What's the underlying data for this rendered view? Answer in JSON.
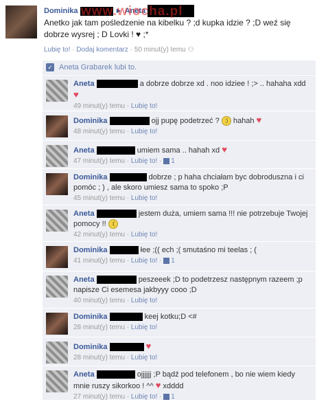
{
  "post": {
    "author": "Dominika",
    "target": "Aneta",
    "watermark": "www.wiocha.pl",
    "text": "Anetko jak tam pośledzenie na kibelku ? ;d kupka idzie ? ;D weź się dobrze wysrej ; D Lovki ! ♥ ;*",
    "like": "Lubię to!",
    "comment": "Dodaj komentarz",
    "time": "50 minut(y) temu",
    "sep": "·"
  },
  "likes": {
    "text": "Aneta Grabarek lubi to."
  },
  "comments": [
    {
      "author": "Aneta",
      "text": "a dobrze dobrze xd . noo idziee ! ;> .. hahaha xdd",
      "time": "49 minut(y) temu",
      "like": "Lubię to!",
      "count": ""
    },
    {
      "author": "Dominika",
      "text": "ojj pupę podetrzeć ?",
      "text2": "hahah",
      "time": "48 minut(y) temu",
      "like": "Lubię to!",
      "count": ""
    },
    {
      "author": "Aneta",
      "text": "umiem sama .. hahah xd",
      "time": "47 minut(y) temu",
      "like": "Lubię to!",
      "count": "1"
    },
    {
      "author": "Dominika",
      "text": "dobrze ; p haha chciałam byc dobroduszna i ci pomóc ; ) , ale skoro umiesz sama to spoko ;P",
      "time": "45 minut(y) temu",
      "like": "Lubię to!",
      "count": ""
    },
    {
      "author": "Aneta",
      "text": "jestem duża, umiem sama !!! nie potrzebuje Twojej pomocy !!",
      "time": "42 minut(y) temu",
      "like": "Lubię to!",
      "count": ""
    },
    {
      "author": "Dominika",
      "text": "łee ;(( ech ;( smutaśno mi teelas ; (",
      "time": "41 minut(y) temu",
      "like": "Lubię to!",
      "count": "1"
    },
    {
      "author": "Aneta",
      "text": "peszeeek ;D to podetrzesz następnym razeem ;p napisze Ci esemesa jakbyyy cooo ;D",
      "time": "40 minut(y) temu",
      "like": "Lubię to!",
      "count": ""
    },
    {
      "author": "Dominika",
      "text": "keej kotku;D <#",
      "time": "28 minut(y) temu",
      "like": "Lubię to!",
      "count": ""
    },
    {
      "author": "Dominika",
      "text": "",
      "time": "28 minut(y) temu",
      "like": "Lubię to!",
      "count": ""
    },
    {
      "author": "Aneta",
      "text": "ojjjjjj ;P bądź pod telefonem , bo nie wiem kiedy mnie ruszy sikorkoo ! ^^",
      "text2": "xdddd",
      "time": "27 minut(y) temu",
      "like": "Lubię to!",
      "count": "1"
    }
  ]
}
